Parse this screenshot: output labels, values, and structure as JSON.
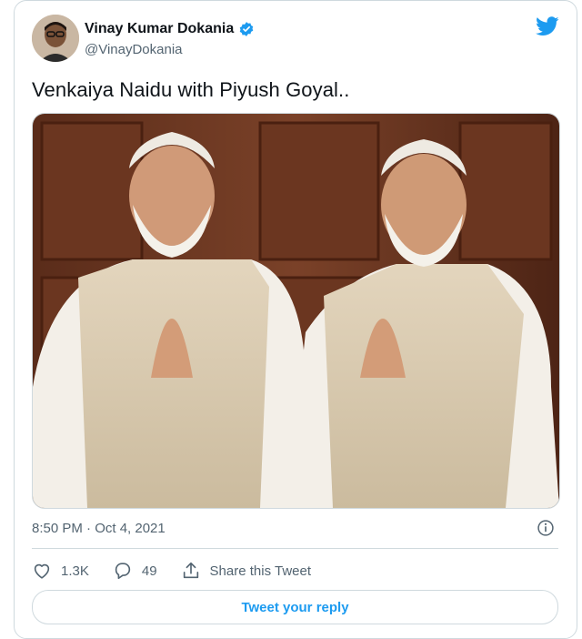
{
  "author": {
    "display_name": "Vinay Kumar Dokania",
    "handle": "@VinayDokania",
    "verified": true
  },
  "tweet": {
    "text": "Venkaiya Naidu with Piyush Goyal..",
    "timestamp": "8:50 PM · Oct 4, 2021"
  },
  "actions": {
    "likes": "1.3K",
    "replies": "49",
    "share_label": "Share this Tweet"
  },
  "reply_button_label": "Tweet your reply",
  "colors": {
    "accent": "#1d9bf0",
    "muted": "#536471",
    "border": "#cfd9de"
  },
  "icons": [
    "verified-badge-icon",
    "twitter-bird-icon",
    "info-icon",
    "heart-icon",
    "reply-bubble-icon",
    "share-icon"
  ]
}
